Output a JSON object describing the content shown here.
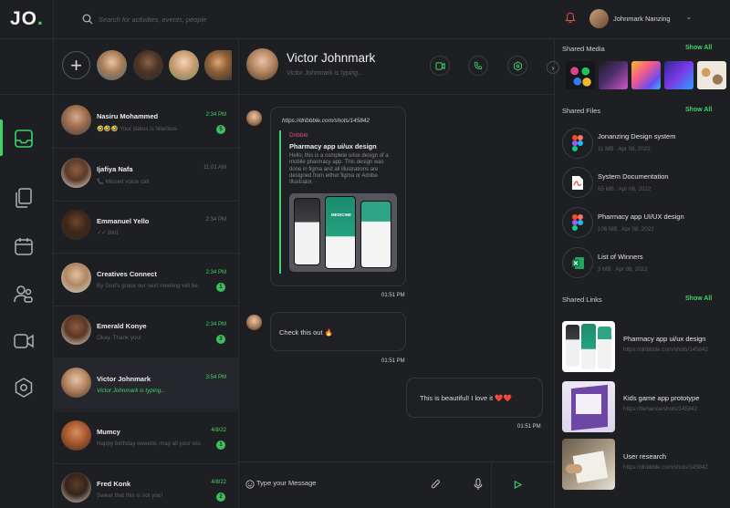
{
  "brand": {
    "logo": "JO",
    "logo_dot": "."
  },
  "search": {
    "placeholder": "Search for activities, events, people"
  },
  "user": {
    "name": "Johnmark Nanzing"
  },
  "rail": {
    "items": [
      "inbox",
      "documents",
      "calendar",
      "contacts",
      "video",
      "settings"
    ],
    "active": "inbox"
  },
  "chats": [
    {
      "name": "Nasiru Mohammed",
      "preview": "🤣🤣🤣 Your status is hilarious",
      "time": "2:34 PM",
      "badge": "5",
      "time_green": true
    },
    {
      "name": "Ijafiya Nafa",
      "preview": "📞 Missed voice call",
      "time": "11:01 AM",
      "badge": "",
      "time_green": false
    },
    {
      "name": "Emmanuel Yello",
      "preview": "✓✓ Bird",
      "time": "2:34 PM",
      "badge": "",
      "time_green": false
    },
    {
      "name": "Creatives Connect",
      "preview": "By God's grace our next meeting will be",
      "time": "2:34 PM",
      "badge": "1",
      "time_green": true
    },
    {
      "name": "Emerald Konye",
      "preview": "Okay. Thank you!",
      "time": "2:34 PM",
      "badge": "3",
      "time_green": true
    },
    {
      "name": "Victor Johnmark",
      "preview": "Victor Johnmark is typing...",
      "time": "3:54 PM",
      "badge": "",
      "time_green": true
    },
    {
      "name": "Mumcy",
      "preview": "Happy birthday sweetie, may all your wis",
      "time": "4/8/22",
      "badge": "1",
      "time_green": true
    },
    {
      "name": "Fred Konk",
      "preview": "Swear that this is not you!",
      "time": "4/8/22",
      "badge": "2",
      "time_green": true
    }
  ],
  "conversation": {
    "name": "Victor Johnmark",
    "status": "Victor Johnmark is typing...",
    "link_message": {
      "url": "https://dribbble.com/shots/145842",
      "source": "Dribble",
      "title": "Pharmacy app ui/ux design",
      "description": "Hello, this is a complete ui/ux design of a mobile pharmacy app. This design was done in figma and all illustrations are designed from either figma or Adobe Illustrator.",
      "image_label": "MEDICINE",
      "time": "01:51 PM"
    },
    "messages": [
      {
        "text": "Check this out 🔥",
        "time": "01:51 PM",
        "side": "left"
      },
      {
        "text": "This is beautiful! I love it ❤️❤️",
        "time": "01:51 PM",
        "side": "right"
      }
    ],
    "composer_placeholder": "Type your Message"
  },
  "shared_media": {
    "title": "Shared Media",
    "show_all": "Show All"
  },
  "shared_files": {
    "title": "Shared Files",
    "show_all": "Show All",
    "items": [
      {
        "name": "Jonanzing Design system",
        "meta": "11 MB . Apr 08, 2022",
        "icon": "figma-icon"
      },
      {
        "name": "System Documentation",
        "meta": "65 MB . Apr 08, 2022",
        "icon": "pdf-icon"
      },
      {
        "name": "Pharmacy app UI/UX design",
        "meta": "106 MB . Apr 08, 2022",
        "icon": "figma-icon"
      },
      {
        "name": "List of Winners",
        "meta": "3 MB . Apr 08, 2022",
        "icon": "excel-icon"
      }
    ]
  },
  "shared_links": {
    "title": "Shared Links",
    "show_all": "Show All",
    "items": [
      {
        "name": "Pharmacy app ui/ux design",
        "url": "https://dribbble.com/shots/145842"
      },
      {
        "name": "Kids game app prototype",
        "url": "https://behance/shots/145842"
      },
      {
        "name": "User research",
        "url": "https://dribbble.com/shots/145842"
      }
    ]
  },
  "colors": {
    "accent": "#3fd468",
    "background": "#1e1f23",
    "divider": "#2c2d33",
    "pink": "#e24f7d"
  }
}
